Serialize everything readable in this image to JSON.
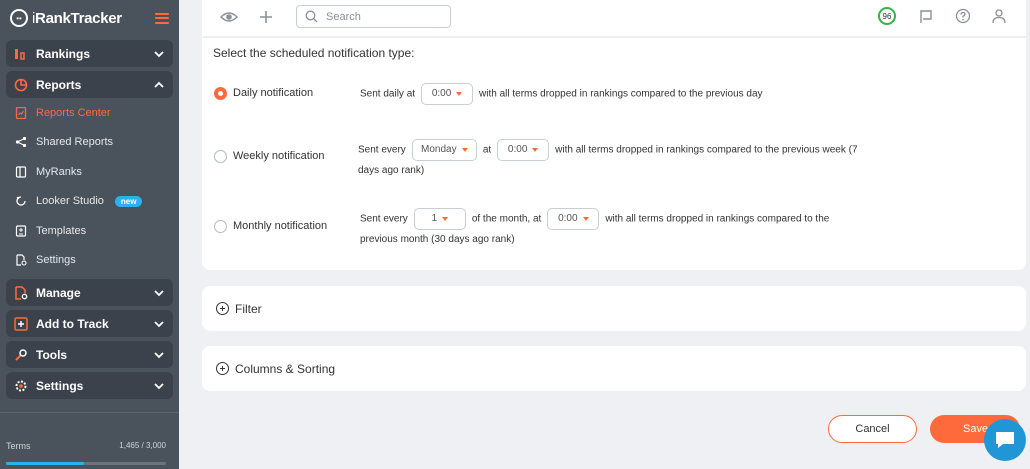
{
  "app": {
    "logo_text_main": "Rank",
    "logo_text_rest": "Tracker",
    "logo_prefix": "i"
  },
  "sidebar": {
    "groups": [
      {
        "label": "Rankings"
      },
      {
        "label": "Reports"
      },
      {
        "label": "Manage"
      },
      {
        "label": "Add to Track"
      },
      {
        "label": "Tools"
      },
      {
        "label": "Settings"
      }
    ],
    "report_items": [
      {
        "label": "Reports Center"
      },
      {
        "label": "Shared Reports"
      },
      {
        "label": "MyRanks"
      },
      {
        "label": "Looker Studio",
        "badge": "new"
      },
      {
        "label": "Templates"
      },
      {
        "label": "Settings"
      }
    ],
    "terms_label": "Terms",
    "terms_count": "1,465 / 3,000",
    "terms_fraction": 0.488
  },
  "topbar": {
    "search_placeholder": "Search",
    "score": "96"
  },
  "notification": {
    "title": "Select the scheduled notification type:",
    "daily": {
      "label": "Daily notification",
      "prefix": "Sent daily at",
      "time": "0:00",
      "suffix": "with all terms dropped in rankings compared to the previous day"
    },
    "weekly": {
      "label": "Weekly notification",
      "prefix": "Sent every",
      "day": "Monday",
      "at": "at",
      "time": "0:00",
      "suffix": "with all terms dropped in rankings compared to the previous week (7",
      "suffix2": "days ago rank)"
    },
    "monthly": {
      "label": "Monthly notification",
      "prefix": "Sent every",
      "day": "1",
      "mid": "of the month, at",
      "time": "0:00",
      "suffix": "with all terms dropped in rankings compared to the",
      "suffix2": "previous month (30 days ago rank)"
    }
  },
  "sections": {
    "filter": "Filter",
    "columns": "Columns & Sorting"
  },
  "buttons": {
    "cancel": "Cancel",
    "save": "Save"
  },
  "colors": {
    "accent": "#ff6a3d",
    "sidebar": "#4a525c",
    "info": "#2ab2f0",
    "score": "#35b34a",
    "chat": "#2196d6"
  }
}
